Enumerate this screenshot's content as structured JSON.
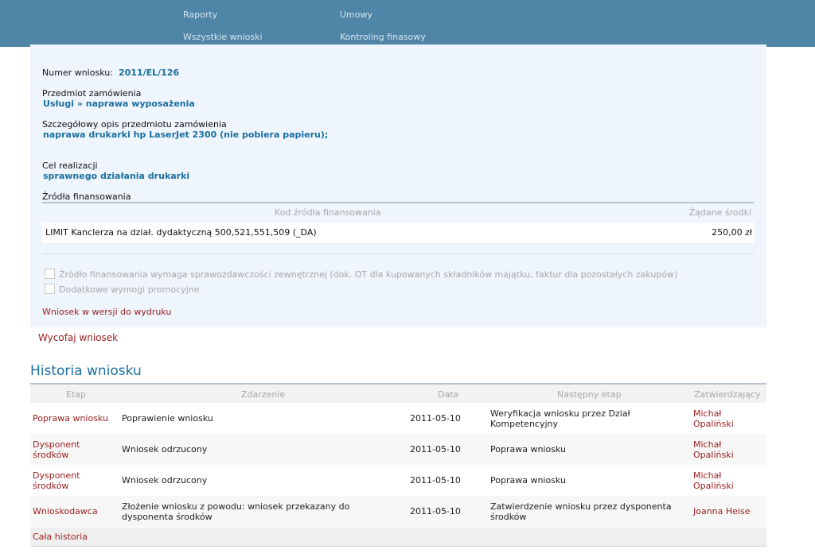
{
  "nav": {
    "raporty": "Raporty",
    "umowy": "Umowy",
    "wszystkie_wnioski": "Wszystkie wnioski",
    "kontroling": "Kontroling finasowy"
  },
  "request": {
    "number_label": "Numer wniosku:",
    "number_value": "2011/EL/126",
    "subject_label": "Przedmiot zamówienia",
    "subject_value": "Usługi » naprawa wyposażenia",
    "desc_label": "Szczegółowy opis przedmiotu zamówienia",
    "desc_value": "naprawa drukarki hp LaserJet 2300 (nie pobiera papieru);",
    "purpose_label": "Cel realizacji",
    "purpose_value": "sprawnego działania drukarki",
    "funding_label": "Źródła finansowania"
  },
  "funding_table": {
    "headers": [
      "Kod źródła finansowania",
      "Żądane środki"
    ],
    "rows": [
      {
        "code": "LIMIT Kanclerza na dział. dydaktyczną 500,521,551,509 (_DA)",
        "amount": "250,00 zł"
      }
    ]
  },
  "checkboxes": [
    {
      "label": "Źródło finansowania wymaga sprawozdawczości zewnętrznej (dok. OT dla kupowanych składników majątku, faktur dla pozostałych zakupów)",
      "checked": false
    },
    {
      "label": "Dodatkowe wymogi promocyjne",
      "checked": false
    }
  ],
  "print_link": "Wniosek w wersji do wydruku",
  "withdraw_link": "Wycofaj wniosek",
  "history": {
    "title": "Historia wniosku",
    "headers": [
      "Etap",
      "Zdarzenie",
      "Data",
      "Następny etap",
      "Zatwierdzający"
    ],
    "rows": [
      {
        "etap": "Poprawa wniosku",
        "zdarzenie": "Poprawienie wniosku",
        "data": "2011-05-10",
        "nastepny": "Weryfikacja wniosku przez Dział Kompetencyjny",
        "zatw": "Michał Opaliński"
      },
      {
        "etap": "Dysponent środków",
        "zdarzenie": "Wniosek odrzucony",
        "data": "2011-05-10",
        "nastepny": "Poprawa wniosku",
        "zatw": "Michał Opaliński"
      },
      {
        "etap": "Dysponent środków",
        "zdarzenie": "Wniosek odrzucony",
        "data": "2011-05-10",
        "nastepny": "Poprawa wniosku",
        "zatw": "Michał Opaliński"
      },
      {
        "etap": "Wnioskodawca",
        "zdarzenie": "Złożenie wniosku z powodu: wniosek przekazany do dysponenta środków",
        "data": "2011-05-10",
        "nastepny": "Zatwierdzenie wniosku przez dysponenta środków",
        "zatw": "Joanna Heise"
      }
    ],
    "all_link": "Cała historia"
  }
}
